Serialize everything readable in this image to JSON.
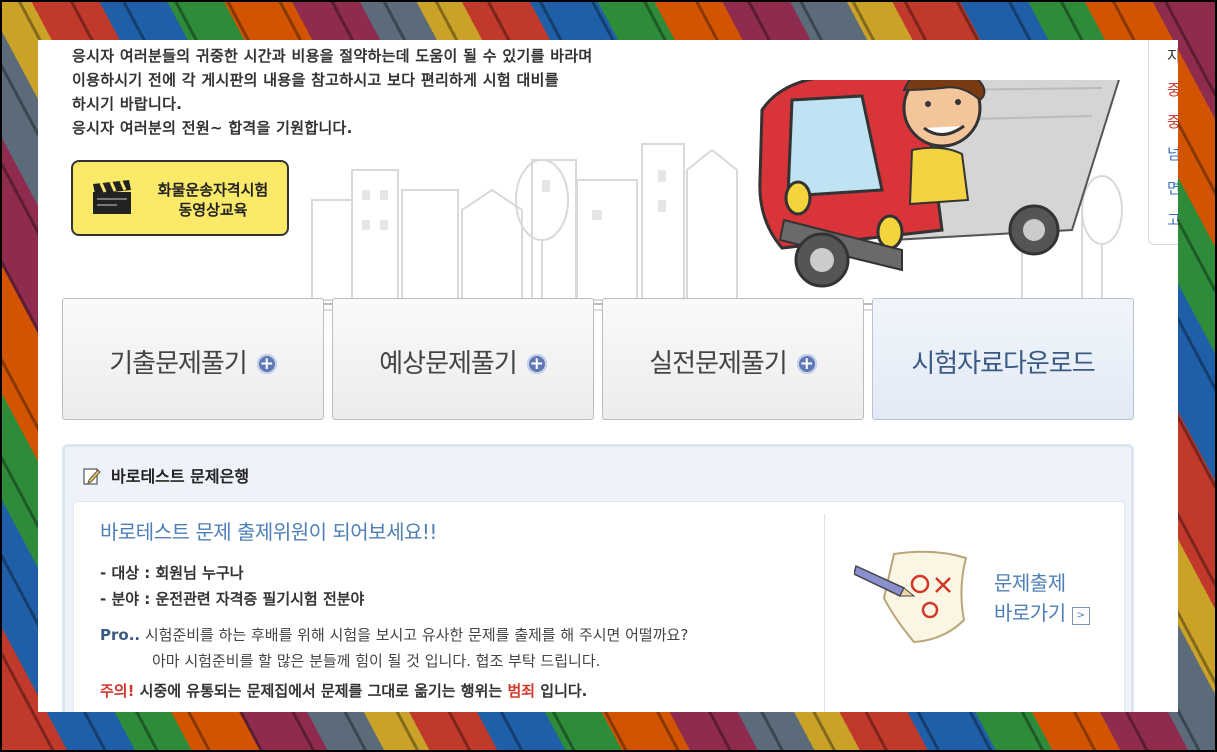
{
  "intro": {
    "lines": [
      "응시자 여러분들의 귀중한 시간과 비용을 절약하는데 도움이 될 수 있기를 바라며",
      "이용하시기  전에 각 게시판의 내용을 참고하시고 보다 편리하게 시험 대비를",
      "하시기 바랍니다.",
      "응시자 여러분의 전원~ 합격을 기원합니다."
    ]
  },
  "video_button": {
    "line1": "화물운송자격시험",
    "line2": "동영상교육"
  },
  "sidebar_clipped": [
    "지",
    "중",
    "중",
    "넘",
    "면",
    "고"
  ],
  "tabs": [
    {
      "label": "기출문제풀기",
      "icon": "plus-circle-icon"
    },
    {
      "label": "예상문제풀기",
      "icon": "plus-circle-icon"
    },
    {
      "label": "실전문제풀기",
      "icon": "plus-circle-icon"
    },
    {
      "label": "시험자료다운로드"
    }
  ],
  "bank": {
    "header": "바로테스트 문제은행",
    "title": "바로테스트 문제 출제위원이 되어보세요!!",
    "target": "- 대상 : 회원님 누구나",
    "field": "- 분야 : 운전관련 자격증 필기시험 전분야",
    "pro_label": "Pro..",
    "pro_line1": " 시험준비를 하는 후배를 위해 시험을 보시고 유사한 문제를 출제를 해 주시면 어떨까요?",
    "pro_line2": "아마 시험준비를 할 많은 분들께 힘이 될 것 입니다. 협조 부탁 드립니다.",
    "warn_label": "주의!",
    "warn_text_a": " 시중에 유통되는 문제집에서 문제를 그대로 옮기는 행위는 ",
    "warn_crime": "범죄",
    "warn_text_b": " 입니다.",
    "go_line1": "문제출제",
    "go_line2": "바로가기"
  },
  "colors": {
    "accent_blue": "#4f7fb8",
    "button_yellow": "#fbe96a",
    "warn_red": "#d0392b",
    "truck_red": "#d8343a"
  }
}
